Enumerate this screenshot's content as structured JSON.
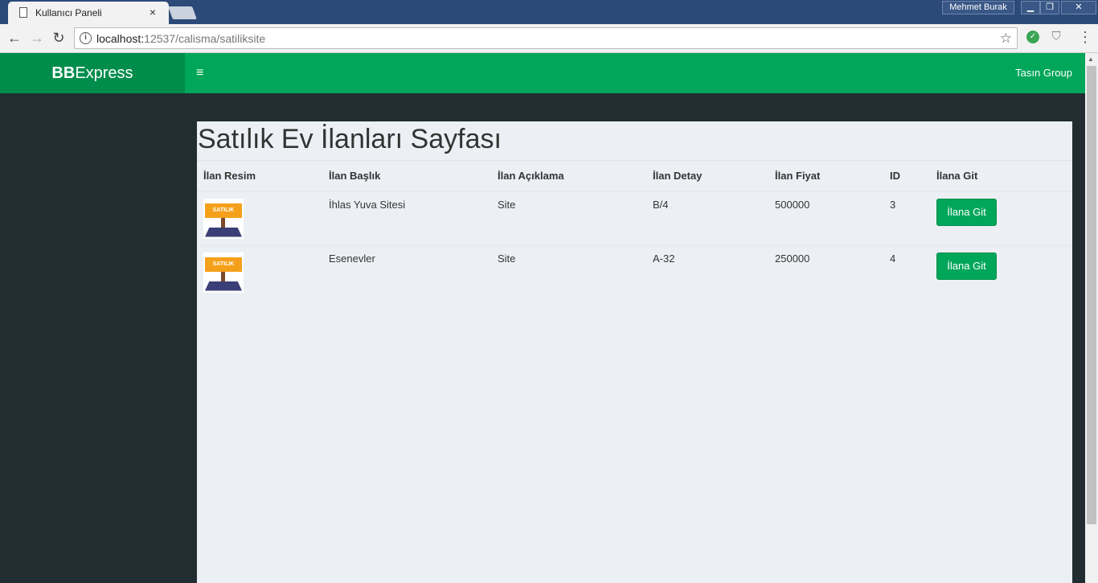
{
  "browser": {
    "tab_title": "Kullanıcı Paneli",
    "tab_close": "×",
    "user_name": "Mehmet Burak",
    "url_host": "localhost:",
    "url_path": "12537/calisma/satiliksite",
    "window_controls": {
      "minimize": "▁",
      "maximize": "❐",
      "close": "✕"
    },
    "icons": {
      "back": "←",
      "forward": "→",
      "reload": "↻",
      "info": "i",
      "star": "☆",
      "menu": "⋮",
      "ext1": "✓",
      "ext2": "⛉"
    }
  },
  "app": {
    "logo_bold": "BB",
    "logo_rest": "Express",
    "menu_icon": "≡",
    "group": "Tasın Group"
  },
  "main": {
    "title": "Satılık Ev İlanları Sayfası",
    "columns": [
      "İlan Resim",
      "İlan Başlık",
      "İlan Açıklama",
      "İlan Detay",
      "İlan Fiyat",
      "ID",
      "İlana Git"
    ],
    "rows": [
      {
        "image_text": "SATILIK",
        "title": "İhlas Yuva Sitesi",
        "description": "Site",
        "detail": "B/4",
        "price": "500000",
        "id": "3",
        "button": "İlana Git"
      },
      {
        "image_text": "SATILIK",
        "title": "Esenevler",
        "description": "Site",
        "detail": "A-32",
        "price": "250000",
        "id": "4",
        "button": "İlana Git"
      }
    ]
  },
  "colors": {
    "accent": "#00a65a",
    "accent_dark": "#008d4c",
    "sidebar": "#222d32",
    "content_bg": "#ecf0f5"
  }
}
